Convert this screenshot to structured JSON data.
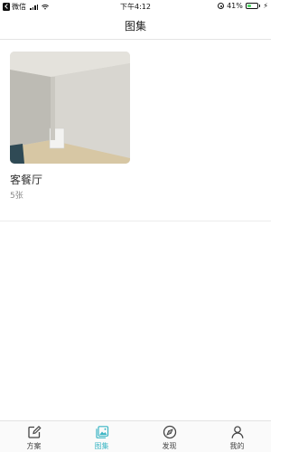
{
  "status_bar": {
    "carrier": "微信",
    "time": "下午4:12",
    "battery_percent": "41%",
    "battery_level": 0.41
  },
  "nav": {
    "title": "图集"
  },
  "albums": [
    {
      "name": "客餐厅",
      "count": "5张"
    }
  ],
  "tab_bar": {
    "active_color": "#3bb5c4",
    "items": [
      {
        "label": "方案",
        "icon": "edit-icon"
      },
      {
        "label": "图集",
        "icon": "gallery-icon",
        "active": true
      },
      {
        "label": "发现",
        "icon": "compass-icon"
      },
      {
        "label": "我的",
        "icon": "user-icon"
      }
    ]
  }
}
